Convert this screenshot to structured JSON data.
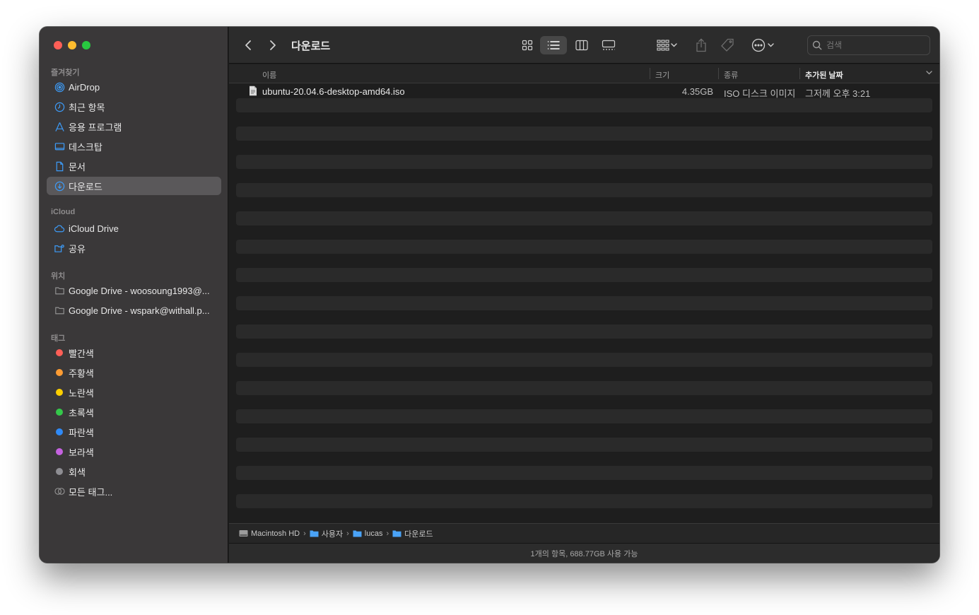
{
  "window": {
    "title": "다운로드"
  },
  "sidebar": {
    "favorites_title": "즐겨찾기",
    "favorites": [
      {
        "label": "AirDrop",
        "icon": "airdrop-icon"
      },
      {
        "label": "최근 항목",
        "icon": "clock-icon"
      },
      {
        "label": "응용 프로그램",
        "icon": "applications-icon"
      },
      {
        "label": "데스크탑",
        "icon": "desktop-icon"
      },
      {
        "label": "문서",
        "icon": "document-icon"
      },
      {
        "label": "다운로드",
        "icon": "download-icon",
        "selected": true
      }
    ],
    "icloud_title": "iCloud",
    "icloud": [
      {
        "label": "iCloud Drive",
        "icon": "cloud-icon"
      },
      {
        "label": "공유",
        "icon": "shared-folder-icon"
      }
    ],
    "locations_title": "위치",
    "locations": [
      {
        "label": "Google Drive - woosoung1993@...",
        "icon": "folder-icon"
      },
      {
        "label": "Google Drive - wspark@withall.p...",
        "icon": "folder-icon"
      }
    ],
    "tags_title": "태그",
    "tags": [
      {
        "label": "빨간색",
        "color": "#fe5f57"
      },
      {
        "label": "주황색",
        "color": "#fd9c33"
      },
      {
        "label": "노란색",
        "color": "#fecf00"
      },
      {
        "label": "초록색",
        "color": "#34c84a"
      },
      {
        "label": "파란색",
        "color": "#2f8af7"
      },
      {
        "label": "보라색",
        "color": "#c562e0"
      },
      {
        "label": "회색",
        "color": "#8e8e93"
      }
    ],
    "all_tags": "모든 태그..."
  },
  "toolbar": {
    "title": "다운로드",
    "search_placeholder": "검색"
  },
  "columns": {
    "name": "이름",
    "size": "크기",
    "kind": "종류",
    "date_added": "추가된 날짜"
  },
  "files": [
    {
      "name": "ubuntu-20.04.6-desktop-amd64.iso",
      "size": "4.35GB",
      "kind": "ISO 디스크 이미지",
      "date_added": "그저께 오후 3:21"
    }
  ],
  "pathbar": [
    "Macintosh HD",
    "사용자",
    "lucas",
    "다운로드"
  ],
  "status": "1개의 항목, 688.77GB 사용 가능",
  "colors": {
    "accent": "#2f8af7",
    "sidebar_bg": "#3a3839",
    "window_bg": "#1e1e1e"
  }
}
